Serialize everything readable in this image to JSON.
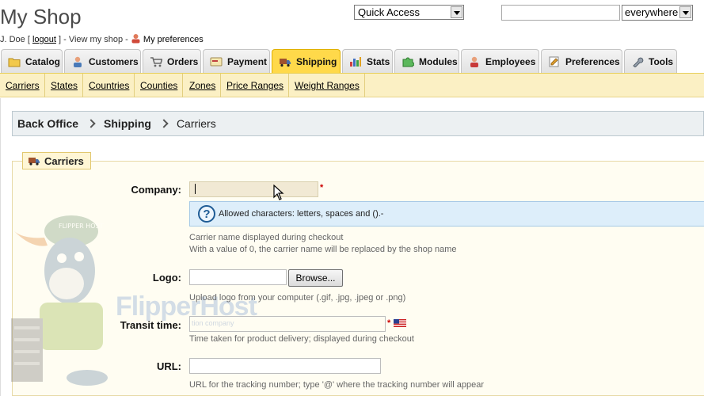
{
  "header": {
    "shop_title": "My Shop",
    "user_name": "J. Doe",
    "logout_label": "logout",
    "view_shop_label": "View my shop",
    "preferences_label": "My preferences",
    "quick_access_value": "Quick Access",
    "search_value": "",
    "search_scope_value": "everywhere"
  },
  "tabs": [
    {
      "label": "Catalog",
      "icon": "folder-icon"
    },
    {
      "label": "Customers",
      "icon": "customer-icon"
    },
    {
      "label": "Orders",
      "icon": "cart-icon"
    },
    {
      "label": "Payment",
      "icon": "payment-icon"
    },
    {
      "label": "Shipping",
      "icon": "truck-icon",
      "active": true
    },
    {
      "label": "Stats",
      "icon": "bar-chart-icon"
    },
    {
      "label": "Modules",
      "icon": "puzzle-icon"
    },
    {
      "label": "Employees",
      "icon": "employee-icon"
    },
    {
      "label": "Preferences",
      "icon": "preferences-icon"
    },
    {
      "label": "Tools",
      "icon": "wrench-icon"
    }
  ],
  "submenu": [
    "Carriers",
    "States",
    "Countries",
    "Counties",
    "Zones",
    "Price Ranges",
    "Weight Ranges"
  ],
  "breadcrumb": [
    "Back Office",
    "Shipping",
    "Carriers"
  ],
  "section": {
    "legend": "Carriers"
  },
  "form": {
    "company": {
      "label": "Company:",
      "value": "",
      "required_mark": "*",
      "tooltip": "Allowed characters: letters, spaces and ().-",
      "hint1": "Carrier name displayed during checkout",
      "hint2": "With a value of 0, the carrier name will be replaced by the shop name"
    },
    "logo": {
      "label": "Logo:",
      "browse_label": "Browse...",
      "hint": "Upload logo from your computer (.gif, .jpg, .jpeg or .png)"
    },
    "transit": {
      "label": "Transit time:",
      "value": "",
      "required_mark": "*",
      "hint": "Time taken for product delivery; displayed during checkout"
    },
    "url": {
      "label": "URL:",
      "value": "",
      "hint": "URL for the tracking number; type '@' where the tracking number will appear"
    }
  },
  "watermark": {
    "brand": "FlipperHost",
    "sub": "tion company",
    "cap_text": "FLIPPER HOST"
  },
  "colors": {
    "active_tab": "#ffd94a",
    "submenu_bg": "#fbf0c4",
    "hint_bg": "#ddeefa",
    "required": "#cc0000"
  }
}
